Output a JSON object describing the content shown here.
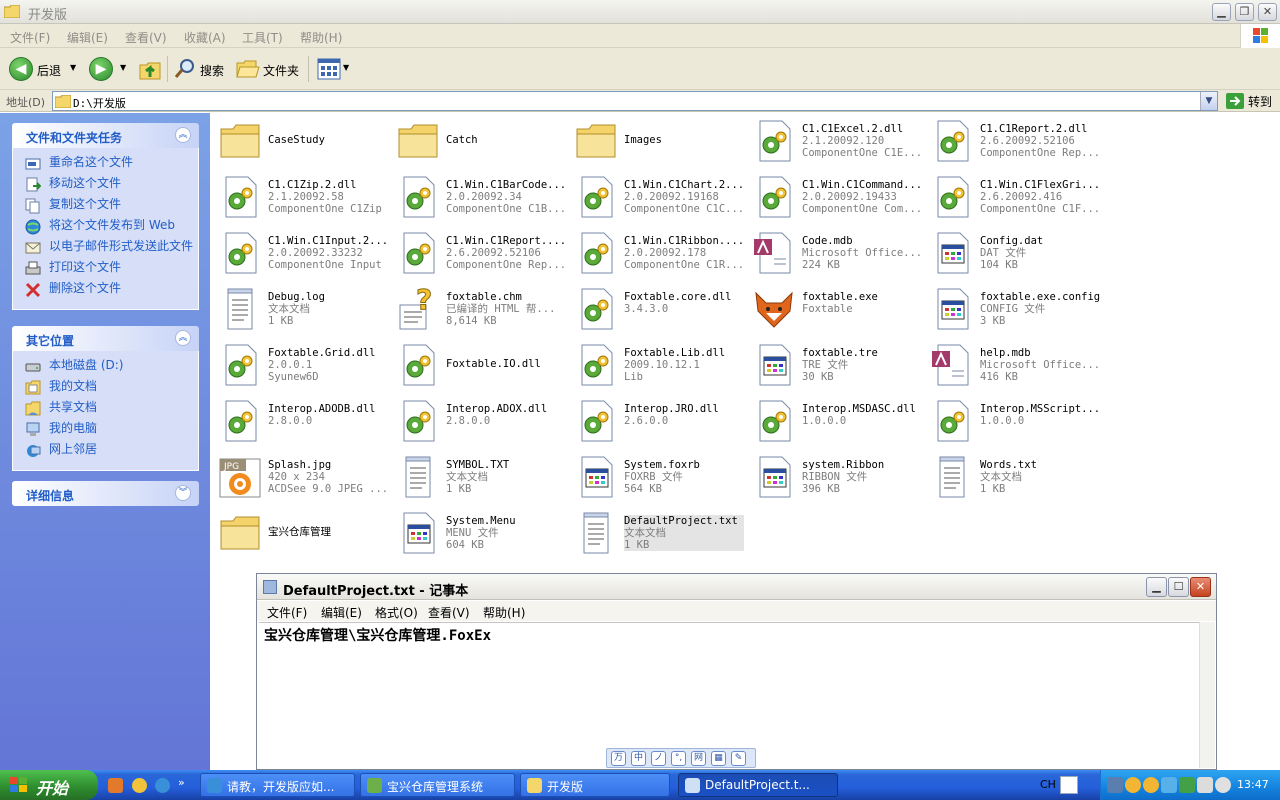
{
  "window": {
    "title": "开发版",
    "menus": [
      "文件(F)",
      "编辑(E)",
      "查看(V)",
      "收藏(A)",
      "工具(T)",
      "帮助(H)"
    ],
    "toolbar": {
      "back": "后退",
      "search": "搜索",
      "folders": "文件夹"
    },
    "address_label": "地址(D)",
    "address_value": "D:\\开发版",
    "go_label": "转到"
  },
  "leftpane": {
    "tasks": {
      "title": "文件和文件夹任务",
      "items": [
        {
          "label": "重命名这个文件",
          "icon": "rename-icon"
        },
        {
          "label": "移动这个文件",
          "icon": "move-icon"
        },
        {
          "label": "复制这个文件",
          "icon": "copy-icon"
        },
        {
          "label": "将这个文件发布到 Web",
          "icon": "publish-web-icon"
        },
        {
          "label": "以电子邮件形式发送此文件",
          "icon": "email-icon"
        },
        {
          "label": "打印这个文件",
          "icon": "print-icon"
        },
        {
          "label": "删除这个文件",
          "icon": "delete-icon"
        }
      ]
    },
    "places": {
      "title": "其它位置",
      "items": [
        {
          "label": "本地磁盘 (D:)",
          "icon": "local-disk-icon"
        },
        {
          "label": "我的文档",
          "icon": "my-documents-icon"
        },
        {
          "label": "共享文档",
          "icon": "shared-documents-icon"
        },
        {
          "label": "我的电脑",
          "icon": "my-computer-icon"
        },
        {
          "label": "网上邻居",
          "icon": "network-places-icon"
        }
      ]
    },
    "details": {
      "title": "详细信息"
    }
  },
  "files": [
    {
      "name": "CaseStudy",
      "type": "folder"
    },
    {
      "name": "Catch",
      "type": "folder"
    },
    {
      "name": "Images",
      "type": "folder"
    },
    {
      "name": "C1.C1Excel.2.dll",
      "line2": "2.1.20092.120",
      "line3": "ComponentOne C1E...",
      "type": "dll"
    },
    {
      "name": "C1.C1Report.2.dll",
      "line2": "2.6.20092.52106",
      "line3": "ComponentOne Rep...",
      "type": "dll"
    },
    {
      "name": "C1.C1Zip.2.dll",
      "line2": "2.1.20092.58",
      "line3": "ComponentOne C1Zip",
      "type": "dll"
    },
    {
      "name": "C1.Win.C1BarCode...",
      "line2": "2.0.20092.34",
      "line3": "ComponentOne C1B...",
      "type": "dll"
    },
    {
      "name": "C1.Win.C1Chart.2...",
      "line2": "2.0.20092.19168",
      "line3": "ComponentOne C1C...",
      "type": "dll"
    },
    {
      "name": "C1.Win.C1Command...",
      "line2": "2.0.20092.19433",
      "line3": "ComponentOne Com...",
      "type": "dll"
    },
    {
      "name": "C1.Win.C1FlexGri...",
      "line2": "2.6.20092.416",
      "line3": "ComponentOne C1F...",
      "type": "dll"
    },
    {
      "name": "C1.Win.C1Input.2...",
      "line2": "2.0.20092.33232",
      "line3": "ComponentOne Input",
      "type": "dll"
    },
    {
      "name": "C1.Win.C1Report....",
      "line2": "2.6.20092.52106",
      "line3": "ComponentOne Rep...",
      "type": "dll"
    },
    {
      "name": "C1.Win.C1Ribbon....",
      "line2": "2.0.20092.178",
      "line3": "ComponentOne C1R...",
      "type": "dll"
    },
    {
      "name": "Code.mdb",
      "line2": "Microsoft Office...",
      "line3": "224 KB",
      "type": "mdb"
    },
    {
      "name": "Config.dat",
      "line2": "DAT 文件",
      "line3": "104 KB",
      "type": "app"
    },
    {
      "name": "Debug.log",
      "line2": "文本文档",
      "line3": "1 KB",
      "type": "txt"
    },
    {
      "name": "foxtable.chm",
      "line2": "已编译的 HTML 帮...",
      "line3": "8,614 KB",
      "type": "chm"
    },
    {
      "name": "Foxtable.core.dll",
      "line2": "3.4.3.0",
      "line3": "",
      "type": "dll"
    },
    {
      "name": "foxtable.exe",
      "line2": "Foxtable",
      "line3": "",
      "type": "fox"
    },
    {
      "name": "foxtable.exe.config",
      "line2": "CONFIG 文件",
      "line3": "3 KB",
      "type": "app"
    },
    {
      "name": "Foxtable.Grid.dll",
      "line2": "2.0.0.1",
      "line3": "Syunew6D",
      "type": "dll"
    },
    {
      "name": "Foxtable.IO.dll",
      "line2": "",
      "line3": "",
      "type": "dll"
    },
    {
      "name": "Foxtable.Lib.dll",
      "line2": "2009.10.12.1",
      "line3": "Lib",
      "type": "dll"
    },
    {
      "name": "foxtable.tre",
      "line2": "TRE 文件",
      "line3": "30 KB",
      "type": "app"
    },
    {
      "name": "help.mdb",
      "line2": "Microsoft Office...",
      "line3": "416 KB",
      "type": "mdb"
    },
    {
      "name": "Interop.ADODB.dll",
      "line2": "2.8.0.0",
      "line3": "",
      "type": "dll"
    },
    {
      "name": "Interop.ADOX.dll",
      "line2": "2.8.0.0",
      "line3": "",
      "type": "dll"
    },
    {
      "name": "Interop.JRO.dll",
      "line2": "2.6.0.0",
      "line3": "",
      "type": "dll"
    },
    {
      "name": "Interop.MSDASC.dll",
      "line2": "1.0.0.0",
      "line3": "",
      "type": "dll"
    },
    {
      "name": "Interop.MSScript...",
      "line2": "1.0.0.0",
      "line3": "",
      "type": "dll"
    },
    {
      "name": "Splash.jpg",
      "line2": "420 x 234",
      "line3": "ACDSee 9.0 JPEG ...",
      "type": "jpg",
      "badge": "JPG"
    },
    {
      "name": "SYMBOL.TXT",
      "line2": "文本文档",
      "line3": "1 KB",
      "type": "txt"
    },
    {
      "name": "System.foxrb",
      "line2": "FOXRB 文件",
      "line3": "564 KB",
      "type": "app"
    },
    {
      "name": "system.Ribbon",
      "line2": "RIBBON 文件",
      "line3": "396 KB",
      "type": "app"
    },
    {
      "name": "Words.txt",
      "line2": "文本文档",
      "line3": "1 KB",
      "type": "txt"
    },
    {
      "name": "宝兴仓库管理",
      "type": "folder"
    },
    {
      "name": "System.Menu",
      "line2": "MENU 文件",
      "line3": "604 KB",
      "type": "app"
    },
    {
      "name": "DefaultProject.txt",
      "line2": "文本文档",
      "line3": "1 KB",
      "type": "txt",
      "selected": true
    }
  ],
  "notepad": {
    "title": "DefaultProject.txt - 记事本",
    "menus": [
      "文件(F)",
      "编辑(E)",
      "格式(O)",
      "查看(V)",
      "帮助(H)"
    ],
    "content": "宝兴仓库管理\\宝兴仓库管理.FoxEx"
  },
  "ime": [
    "万",
    "中",
    "ノ",
    "°,",
    "网",
    "▦",
    "✎"
  ],
  "taskbar": {
    "start": "开始",
    "buttons": [
      {
        "label": "请教，开发版应如...",
        "icon": "ie-icon",
        "active": false
      },
      {
        "label": "宝兴仓库管理系统",
        "icon": "app-icon",
        "active": false
      },
      {
        "label": "开发版",
        "icon": "folder-icon",
        "active": false
      },
      {
        "label": "DefaultProject.t...",
        "icon": "notepad-icon",
        "active": true
      }
    ],
    "language": "CH",
    "clock": "13:47"
  },
  "colors": {
    "taskpane_text": "#215dc6",
    "taskbar_blue": "#245edb",
    "start_green": "#2f8e2f"
  }
}
